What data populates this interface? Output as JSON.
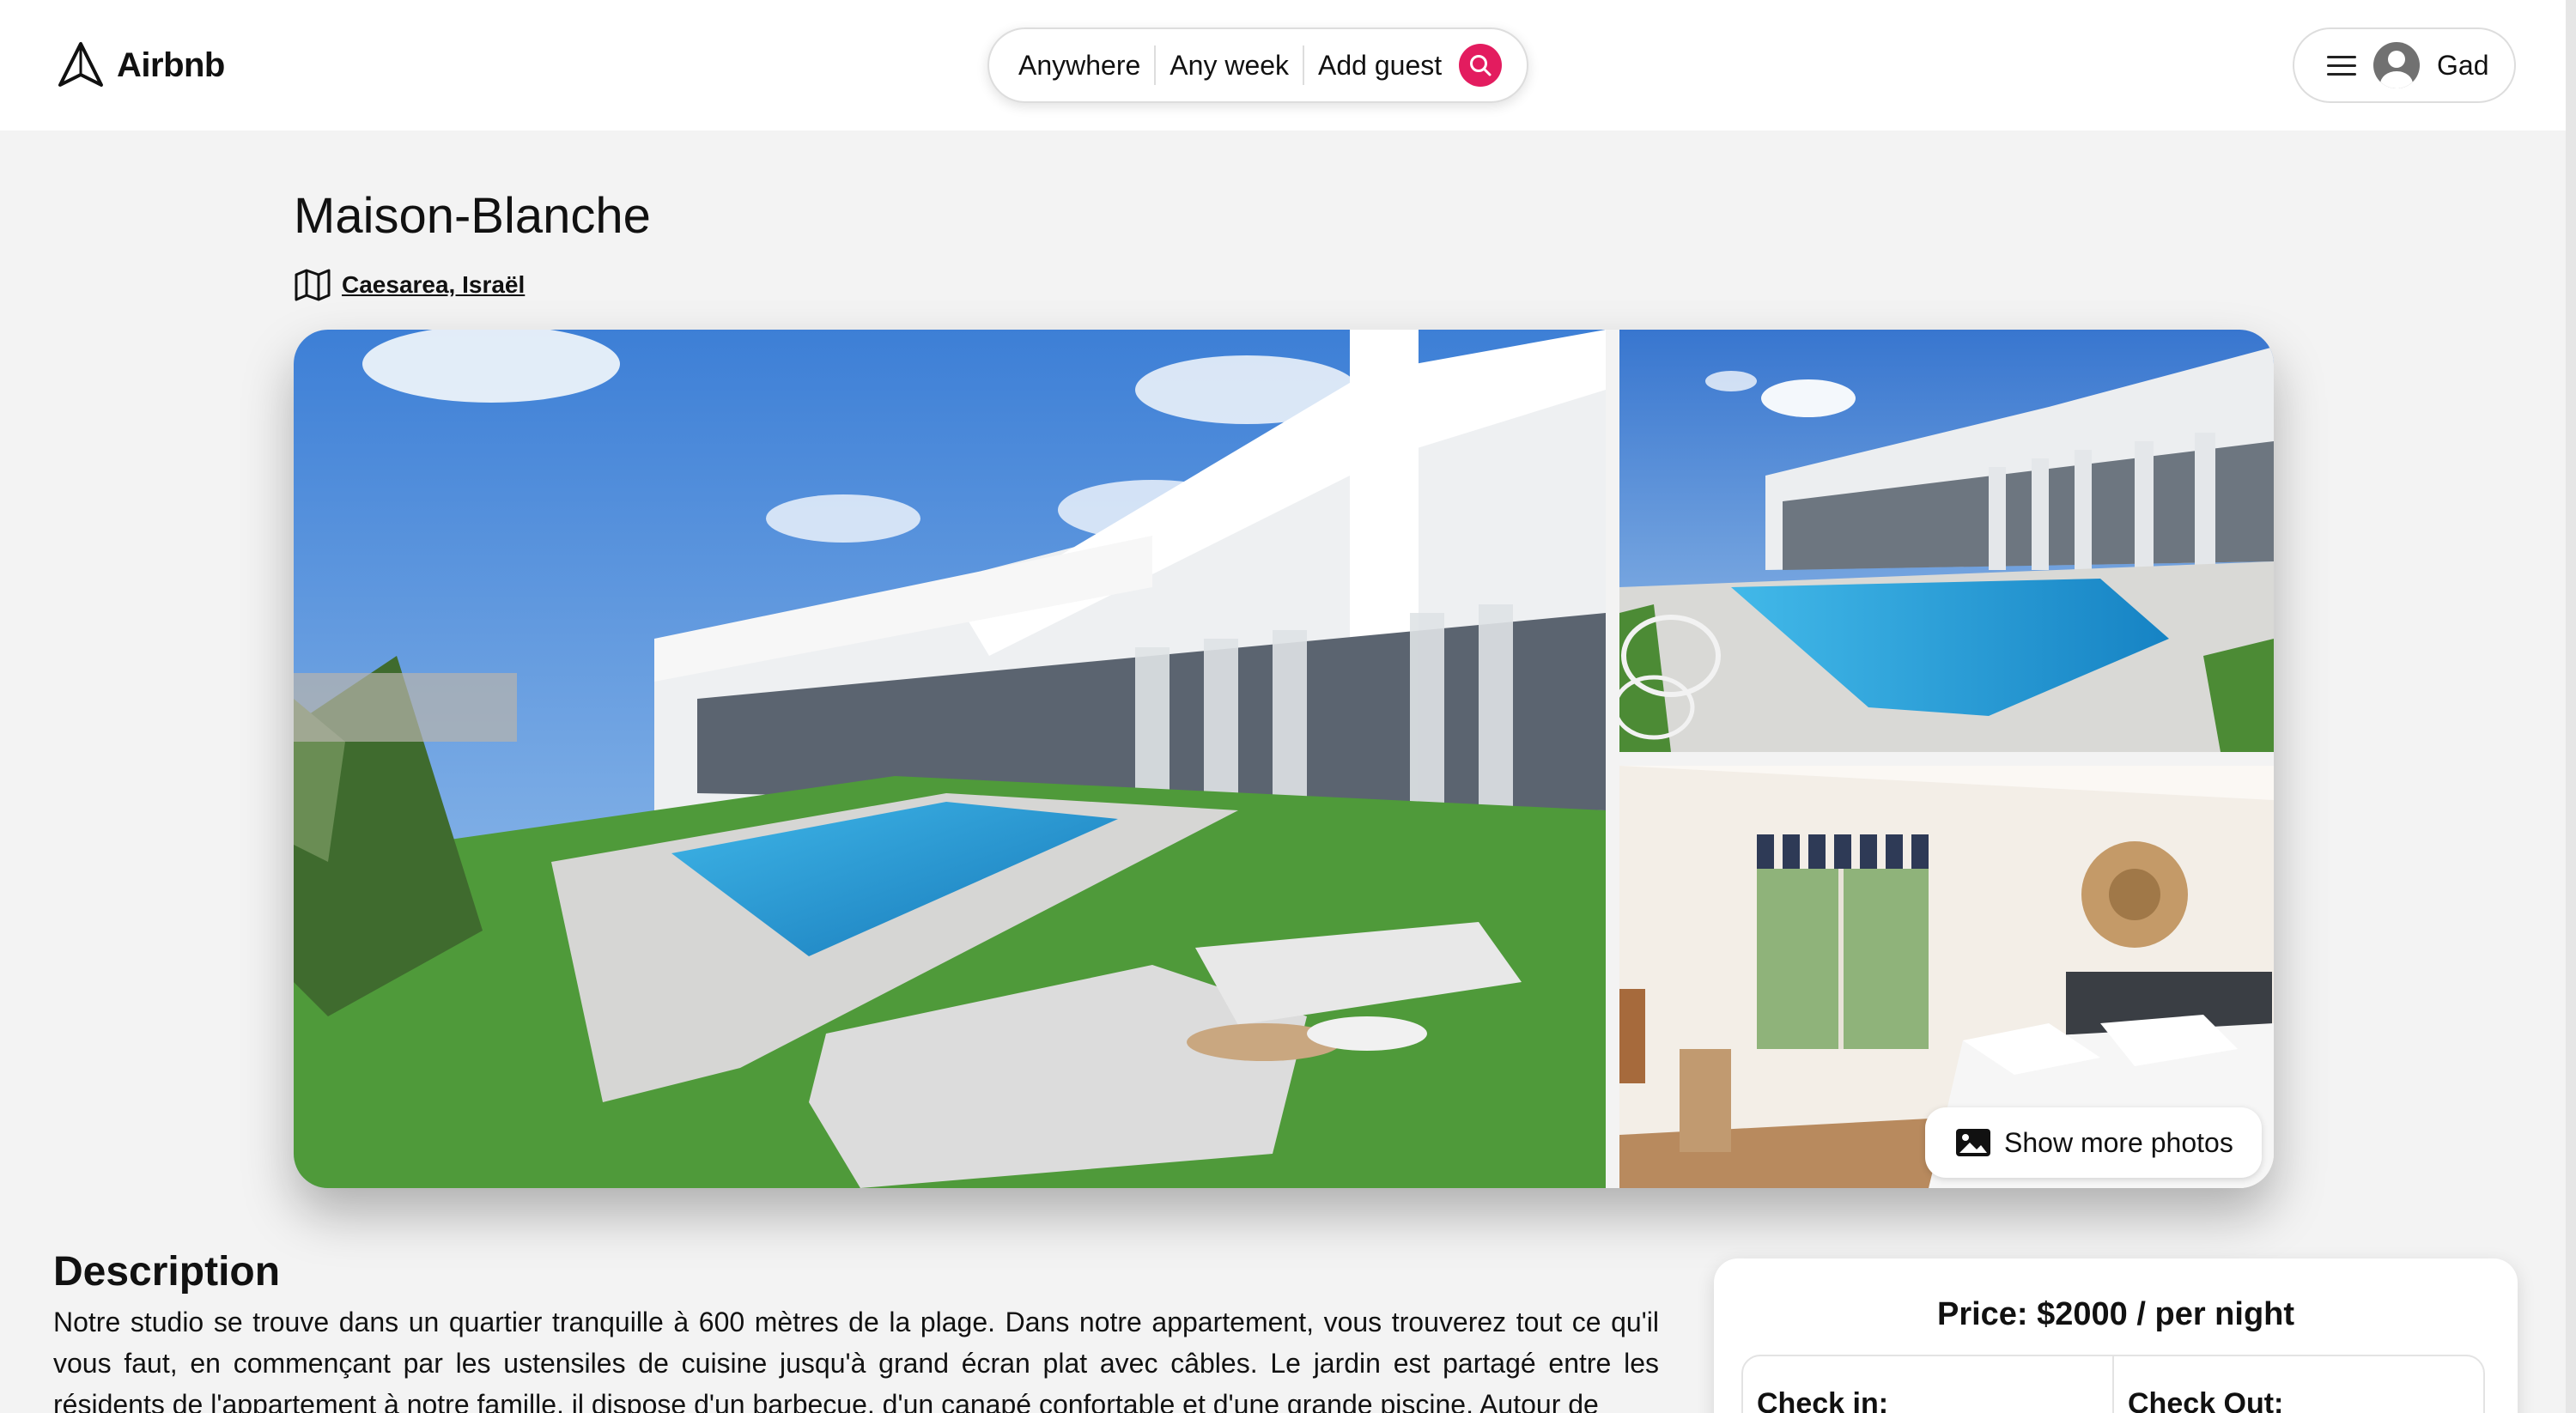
{
  "header": {
    "brand": "Airbnb",
    "search": {
      "anywhere": "Anywhere",
      "any_week": "Any week",
      "add_guest": "Add guest"
    },
    "user_name": "Gad",
    "accent_color": "#e31c5f"
  },
  "listing": {
    "title": "Maison-Blanche",
    "location": "Caesarea, Israël",
    "show_more_photos": "Show more photos",
    "photos": [
      "pool-villa-exterior",
      "pool-aerial-view",
      "bedroom-interior"
    ]
  },
  "description": {
    "heading": "Description",
    "text": "Notre studio se trouve dans un quartier tranquille à 600 mètres de la plage. Dans notre appartement, vous trouverez tout ce qu'il vous faut, en commençant par les ustensiles de cuisine jusqu'à grand écran plat avec câbles. Le jardin est partagé entre les résidents de l'appartement à notre famille, il dispose d'un barbecue, d'un canapé confortable et d'une grande piscine. Autour de"
  },
  "booking": {
    "price": "Price: $2000 / per night",
    "check_in": "Check in:",
    "check_out": "Check Out:"
  }
}
